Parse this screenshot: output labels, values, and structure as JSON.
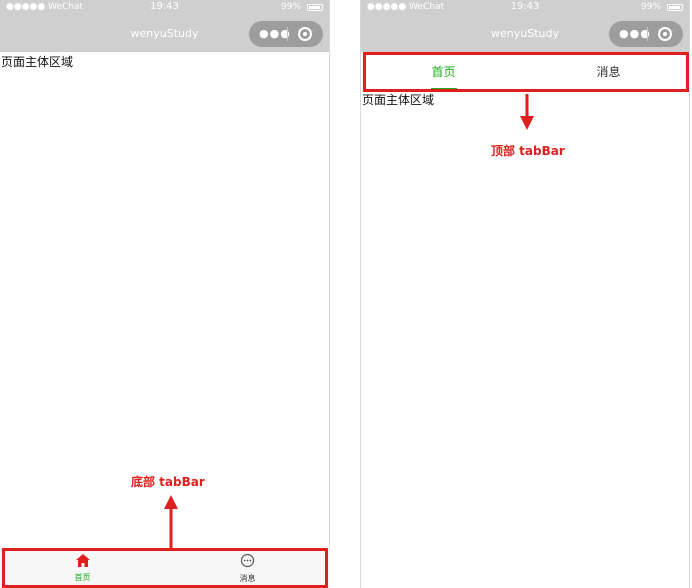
{
  "colors": {
    "active_tab": "#1aad19",
    "annotation": "#e0201e",
    "navbar_bg": "#cfcfcf",
    "inactive_tab": "#333333"
  },
  "statusbar": {
    "carrier": "●●●●● WeChat",
    "time": "19:43",
    "battery": "99%",
    "wifi_icon": "wifi-icon",
    "battery_icon": "battery-icon"
  },
  "navbar": {
    "title": "wenyuStudy",
    "menu_icon": "more-dots-icon",
    "close_icon": "target-icon"
  },
  "page": {
    "main_text": "页面主体区域"
  },
  "bottom_tabbar": {
    "tabs": [
      {
        "label": "首页",
        "icon": "home-icon",
        "active": true
      },
      {
        "label": "消息",
        "icon": "message-icon",
        "active": false
      }
    ],
    "annotation": "底部 tabBar"
  },
  "top_tabbar": {
    "tabs": [
      {
        "label": "首页",
        "active": true
      },
      {
        "label": "消息",
        "active": false
      }
    ],
    "annotation": "顶部 tabBar"
  }
}
